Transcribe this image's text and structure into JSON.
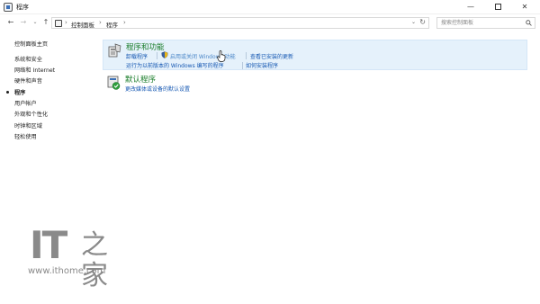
{
  "window": {
    "title": "程序",
    "controls": {
      "minimize": "—",
      "maximize": "",
      "close": "✕"
    }
  },
  "nav": {
    "back": "←",
    "forward": "→",
    "history": "⌄",
    "up": "↑",
    "breadcrumbs": [
      "控制面板",
      "程序"
    ],
    "separator": "›",
    "dropdown": "⌄",
    "refresh": "↻",
    "search_placeholder": "搜索控制面板"
  },
  "sidebar": {
    "items": [
      {
        "label": "控制面板主页"
      },
      {
        "label": "系统和安全"
      },
      {
        "label": "网络和 Internet"
      },
      {
        "label": "硬件和声音"
      },
      {
        "label": "程序",
        "current": true
      },
      {
        "label": "用户帐户"
      },
      {
        "label": "外观和个性化"
      },
      {
        "label": "时钟和区域"
      },
      {
        "label": "轻松使用"
      }
    ]
  },
  "categories": [
    {
      "title": "程序和功能",
      "links_row1": [
        "卸载程序",
        "启用或关闭 Windows 功能",
        "查看已安装的更新"
      ],
      "links_row2": [
        "运行为以前版本的 Windows 编写的程序",
        "如何安装程序"
      ]
    },
    {
      "title": "默认程序",
      "links_row1": [
        "更改媒体或设备的默认设置"
      ]
    }
  ],
  "watermark": {
    "logo_text": "IT",
    "logo_glyph": "之家",
    "url": "www.ithome.com"
  },
  "colors": {
    "category_title": "#1a7d2a",
    "link": "#1457b2",
    "highlight_bg": "#e5f1fb"
  }
}
